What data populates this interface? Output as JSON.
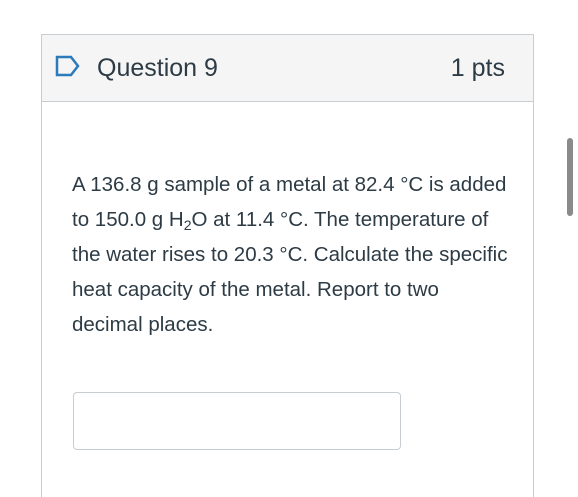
{
  "question": {
    "title": "Question 9",
    "points": "1 pts",
    "text_before_h2o": "A 136.8 g sample of a metal at 82.4 °C is added to 150.0 g H",
    "h2o_subscript": "2",
    "text_after_h2o": "O at 11.4 °C. The temperature of the water rises to 20.3 °C. Calculate the specific heat capacity of the metal. Report to two decimal places.",
    "answer": {
      "value": "",
      "placeholder": ""
    }
  },
  "icons": {
    "flag": "flag-outline-icon"
  },
  "colors": {
    "header_bg": "#f5f5f5",
    "border": "#c7cdd1",
    "text": "#2d3b45",
    "flag": "#2b7abc"
  }
}
